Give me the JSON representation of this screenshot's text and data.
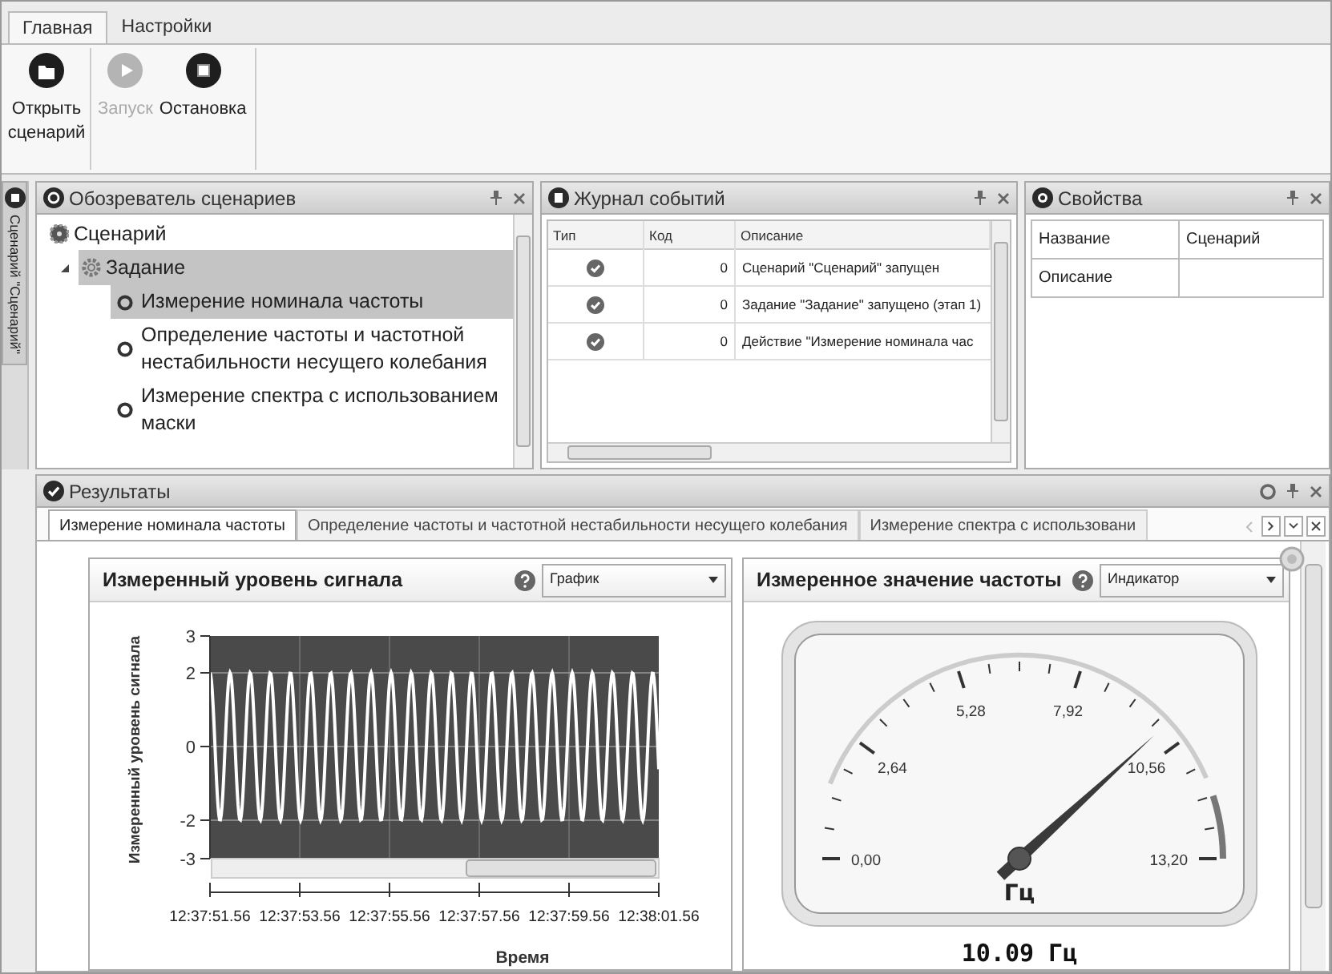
{
  "ribbon": {
    "tabs": [
      {
        "label": "Главная",
        "selected": true
      },
      {
        "label": "Настройки",
        "selected": false
      }
    ],
    "buttons": [
      {
        "label": "Открыть сценарий",
        "kind": "folder",
        "disabled": false
      },
      {
        "label": "Запуск",
        "kind": "play",
        "disabled": true
      },
      {
        "label": "Остановка",
        "kind": "stop",
        "disabled": false
      }
    ]
  },
  "side_tab": {
    "label": "Сценарий \"Сценарий\""
  },
  "explorer": {
    "title": "Обозреватель сценариев",
    "tree": [
      {
        "label": "Сценарий",
        "selected": false,
        "children": [
          {
            "label": "Задание",
            "selected": true,
            "expanded": true,
            "children": [
              {
                "label": "Измерение номинала частоты",
                "selected": true
              },
              {
                "label": "Определение частоты и частотной нестабильности несущего колебания",
                "selected": false
              },
              {
                "label": "Измерение спектра с использованием маски",
                "selected": false
              }
            ]
          }
        ]
      }
    ]
  },
  "journal": {
    "title": "Журнал событий",
    "columns": [
      "Тип",
      "Код",
      "Описание"
    ],
    "rows": [
      {
        "code": "0",
        "description": "Сценарий \"Сценарий\" запущен"
      },
      {
        "code": "0",
        "description": "Задание \"Задание\" запущено (этап 1)"
      },
      {
        "code": "0",
        "description": "Действие \"Измерение номинала час"
      }
    ]
  },
  "properties": {
    "title": "Свойства",
    "rows": [
      {
        "name": "Название",
        "value": "Сценарий"
      },
      {
        "name": "Описание"
      }
    ]
  },
  "results": {
    "title": "Результаты",
    "tabs": [
      {
        "label": "Измерение номинала частоты",
        "selected": true
      },
      {
        "label": "Определение частоты и частотной нестабильности несущего колебания",
        "selected": false
      },
      {
        "label": "Измерение спектра с использовани",
        "selected": false
      }
    ],
    "signal_card": {
      "title": "Измеренный уровень сигнала",
      "view": "График",
      "ylabel": "Измеренный уровень сигнала",
      "yticks": [
        "3",
        "2",
        "0",
        "-2",
        "-3"
      ],
      "xticks": [
        "12:37:51.56",
        "12:37:53.56",
        "12:37:55.56",
        "12:37:57.56",
        "12:37:59.56",
        "12:38:01.56"
      ],
      "xlabel": "Время"
    },
    "frequency_card": {
      "title": "Измеренное значение частоты",
      "view": "Индикатор",
      "gauge": {
        "tick_labels": [
          "0,00",
          "2,64",
          "5,28",
          "7,92",
          "10,56",
          "13,20"
        ],
        "unit": "Гц",
        "reading": "10.09 Гц"
      }
    }
  }
}
